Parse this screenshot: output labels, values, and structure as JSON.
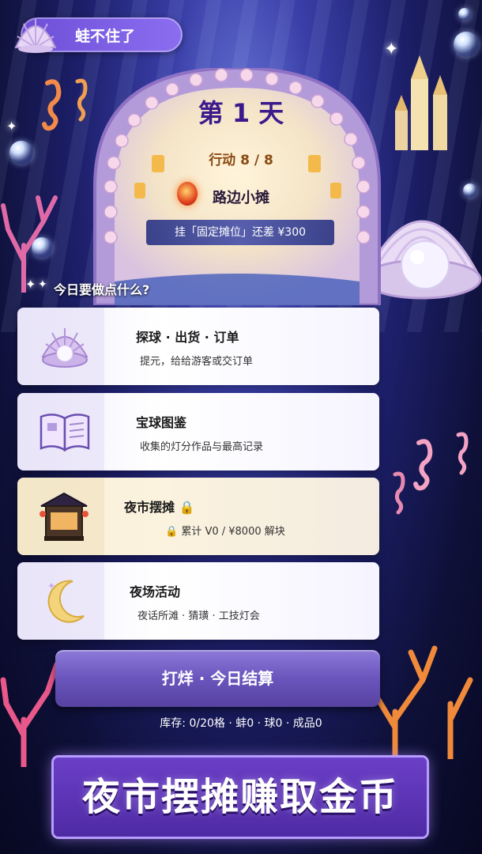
{
  "header": {
    "title": "蛙不住了"
  },
  "day_panel": {
    "day_title": "第 1 天",
    "action_text": "行动 8 / 8",
    "stall_name": "路边小摊",
    "goal_text": "挂「固定摊位」还差 ¥300"
  },
  "menu": {
    "section_label": "今日要做点什么?",
    "items": [
      {
        "title": "探球 · 出货 · 订单",
        "subtitle": "提元，给给游客或交订单",
        "icon": "pearl-shell-icon"
      },
      {
        "title": "宝球图鉴",
        "subtitle": "收集的灯分作品与最高记录",
        "icon": "book-icon"
      },
      {
        "title": "夜市摆摊",
        "subtitle": "累计 V0 / ¥8000 解块",
        "icon": "night-stall-icon",
        "locked": true
      },
      {
        "title": "夜场活动",
        "subtitle": "夜话所滩 · 猜璜 · 工技灯会",
        "icon": "moon-icon"
      }
    ]
  },
  "settle_button": {
    "label": "打烊 · 今日结算"
  },
  "inventory": {
    "text": "库存: 0/20格 · 蚌0 · 球0 · 成品0"
  },
  "banner": {
    "text": "夜市摆摊赚取金币"
  },
  "colors": {
    "accent": "#6c4fd6",
    "day_title": "#3b1a8c",
    "action": "#8a4a12"
  }
}
